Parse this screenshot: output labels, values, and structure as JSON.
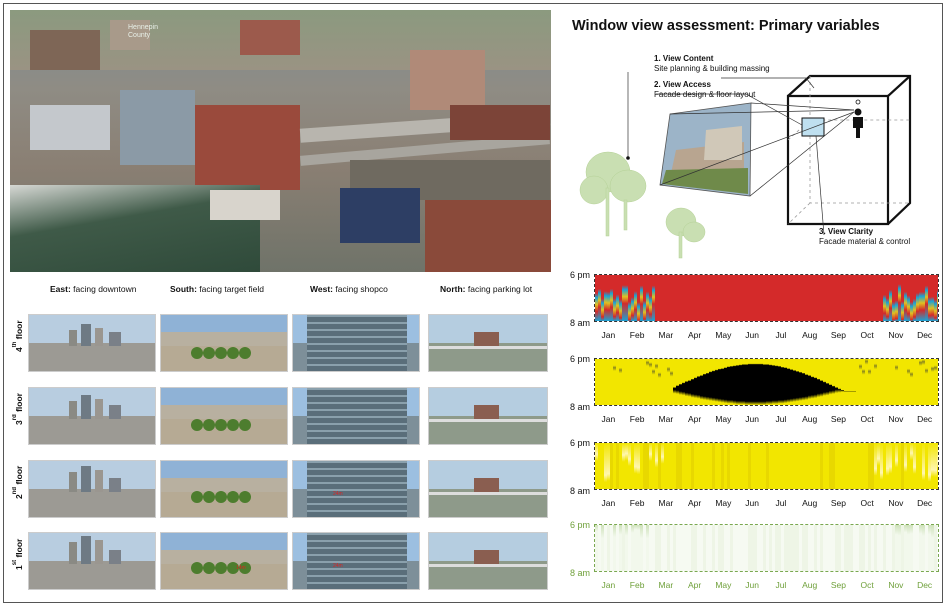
{
  "aerial": {
    "label_line1": "Hennepin",
    "label_line2": "County"
  },
  "grid": {
    "columns": [
      {
        "dir": "East:",
        "text": " facing downtown"
      },
      {
        "dir": "South:",
        "text": " facing target field"
      },
      {
        "dir": "West:",
        "text": " facing shopco"
      },
      {
        "dir": "North:",
        "text": " facing parking lot"
      }
    ],
    "rows": [
      {
        "num": "4",
        "sup": "th",
        "word": " floor"
      },
      {
        "num": "3",
        "sup": "rd",
        "word": " floor"
      },
      {
        "num": "2",
        "sup": "nd",
        "word": " floor"
      },
      {
        "num": "1",
        "sup": "st",
        "word": " floor"
      }
    ]
  },
  "diagram": {
    "title": "Window view assessment: Primary variables",
    "view_content_title": "1. View Content",
    "view_content_desc": "Site planning & building massing",
    "view_access_title": "2. View Access",
    "view_access_desc": "Facade design & floor layout",
    "view_clarity_title": "3. View Clarity",
    "view_clarity_desc": "Facade material & control"
  },
  "heatmaps": {
    "y_top": "6 pm",
    "y_bottom": "8 am",
    "months": [
      "Jan",
      "Feb",
      "Mar",
      "Apr",
      "May",
      "Jun",
      "Jul",
      "Aug",
      "Sep",
      "Oct",
      "Nov",
      "Dec"
    ]
  },
  "colors": {
    "red": "#d42a2a",
    "blue": "#1aa3d6",
    "yellow": "#f2e600",
    "olive": "#8e8a1c",
    "green": "#6fa03a"
  }
}
